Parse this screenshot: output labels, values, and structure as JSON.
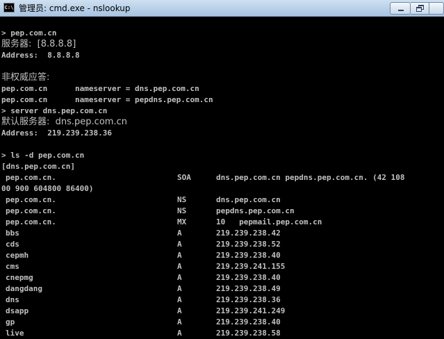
{
  "window": {
    "title": "管理员: cmd.exe - nslookup",
    "icon_label": "C:\\"
  },
  "console": {
    "lines": [
      {
        "text": "> pep.com.cn"
      },
      {
        "text": "服务器:  [8.8.8.8]"
      },
      {
        "text": "Address:  8.8.8.8"
      },
      {
        "text": ""
      },
      {
        "text": "非权威应答:"
      },
      {
        "text": "pep.com.cn      nameserver = dns.pep.com.cn"
      },
      {
        "text": "pep.com.cn      nameserver = pepdns.pep.com.cn"
      },
      {
        "text": "> server dns.pep.com.cn"
      },
      {
        "text": "默认服务器:  dns.pep.com.cn"
      },
      {
        "text": "Address:  219.239.238.36"
      },
      {
        "text": ""
      },
      {
        "text": "> ls -d pep.com.cn"
      },
      {
        "text": "[dns.pep.com.cn]"
      }
    ],
    "records": [
      {
        "name": "pep.com.cn.",
        "type": "SOA",
        "data": "dns.pep.com.cn pepdns.pep.com.cn. (42 108"
      },
      {
        "continuation": "00 900 604800 86400)"
      },
      {
        "name": "pep.com.cn.",
        "type": "NS",
        "data": "dns.pep.com.cn"
      },
      {
        "name": "pep.com.cn.",
        "type": "NS",
        "data": "pepdns.pep.com.cn"
      },
      {
        "name": "pep.com.cn.",
        "type": "MX",
        "data": "10   pepmail.pep.com.cn"
      },
      {
        "name": "bbs",
        "type": "A",
        "data": "219.239.238.42"
      },
      {
        "name": "cds",
        "type": "A",
        "data": "219.239.238.52"
      },
      {
        "name": "cepmh",
        "type": "A",
        "data": "219.239.238.40"
      },
      {
        "name": "cms",
        "type": "A",
        "data": "219.239.241.155"
      },
      {
        "name": "cnepmg",
        "type": "A",
        "data": "219.239.238.40"
      },
      {
        "name": "dangdang",
        "type": "A",
        "data": "219.239.238.49"
      },
      {
        "name": "dns",
        "type": "A",
        "data": "219.239.238.36"
      },
      {
        "name": "dsapp",
        "type": "A",
        "data": "219.239.241.249"
      },
      {
        "name": "gp",
        "type": "A",
        "data": "219.239.238.40"
      },
      {
        "name": "live",
        "type": "A",
        "data": "219.239.238.58"
      }
    ]
  }
}
